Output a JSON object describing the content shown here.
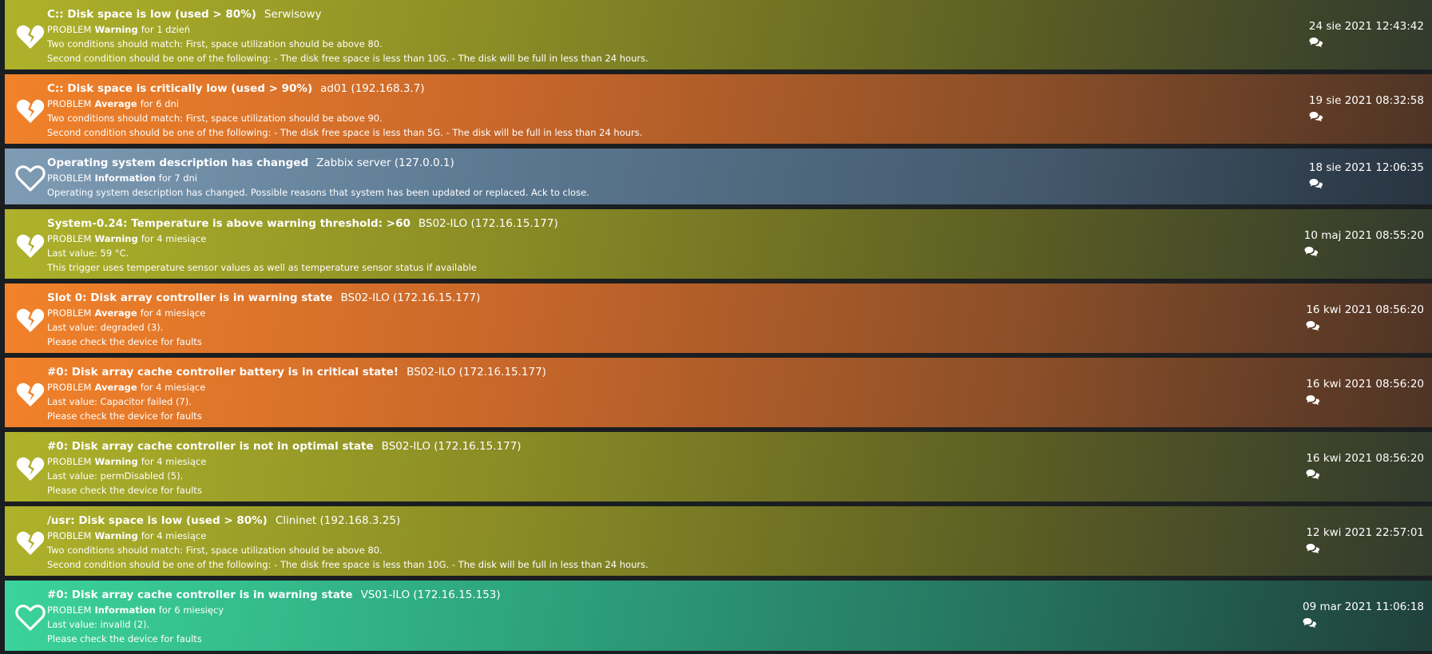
{
  "colors": {
    "warning": "#aeb22a",
    "average": "#f2822a",
    "information": "#7f9cb5",
    "information_green": "#3bd39c",
    "background": "#1b1e20"
  },
  "icons": {
    "broken": "broken-heart-icon",
    "whole": "heart-icon",
    "comment": "comment-icon"
  },
  "problems": [
    {
      "trigger": "C:: Disk space is low (used > 80%)",
      "host": "Serwisowy",
      "status": "PROBLEM",
      "severity": "Warning",
      "duration": "for 1 dzień",
      "desc": [
        "Two conditions should match: First, space utilization should be above 80.",
        "Second condition should be one of the following: - The disk free space is less than 10G. - The disk will be full in less than 24 hours."
      ],
      "time": "24 sie 2021 12:43:42"
    },
    {
      "trigger": "C:: Disk space is critically low (used > 90%)",
      "host": "ad01 (192.168.3.7)",
      "status": "PROBLEM",
      "severity": "Average",
      "duration": "for 6 dni",
      "desc": [
        "Two conditions should match: First, space utilization should be above 90.",
        "Second condition should be one of the following: - The disk free space is less than 5G. - The disk will be full in less than 24 hours."
      ],
      "time": "19 sie 2021 08:32:58"
    },
    {
      "trigger": "Operating system description has changed",
      "host": "Zabbix server (127.0.0.1)",
      "status": "PROBLEM",
      "severity": "Information",
      "duration": "for 7 dni",
      "desc": [
        "Operating system description has changed. Possible reasons that system has been updated or replaced. Ack to close."
      ],
      "time": "18 sie 2021 12:06:35"
    },
    {
      "trigger": "System-0.24: Temperature is above warning threshold: >60",
      "host": "BS02-ILO (172.16.15.177)",
      "status": "PROBLEM",
      "severity": "Warning",
      "duration": "for 4 miesiące",
      "desc": [
        "Last value: 59 °C.",
        "This trigger uses temperature sensor values as well as temperature sensor status if available"
      ],
      "time": "10 maj 2021 08:55:20"
    },
    {
      "trigger": "Slot 0: Disk array controller is in warning state",
      "host": "BS02-ILO (172.16.15.177)",
      "status": "PROBLEM",
      "severity": "Average",
      "duration": "for 4 miesiące",
      "desc": [
        "Last value: degraded (3).",
        "Please check the device for faults"
      ],
      "time": "16 kwi 2021 08:56:20"
    },
    {
      "trigger": "#0: Disk array cache controller battery is in critical state!",
      "host": "BS02-ILO (172.16.15.177)",
      "status": "PROBLEM",
      "severity": "Average",
      "duration": "for 4 miesiące",
      "desc": [
        "Last value: Capacitor failed (7).",
        "Please check the device for faults"
      ],
      "time": "16 kwi 2021 08:56:20"
    },
    {
      "trigger": "#0: Disk array cache controller is not in optimal state",
      "host": "BS02-ILO (172.16.15.177)",
      "status": "PROBLEM",
      "severity": "Warning",
      "duration": "for 4 miesiące",
      "desc": [
        "Last value: permDisabled (5).",
        "Please check the device for faults"
      ],
      "time": "16 kwi 2021 08:56:20"
    },
    {
      "trigger": "/usr: Disk space is low (used > 80%)",
      "host": "Clininet (192.168.3.25)",
      "status": "PROBLEM",
      "severity": "Warning",
      "duration": "for 4 miesiące",
      "desc": [
        "Two conditions should match: First, space utilization should be above 80.",
        "Second condition should be one of the following: - The disk free space is less than 10G. - The disk will be full in less than 24 hours."
      ],
      "time": "12 kwi 2021 22:57:01"
    },
    {
      "trigger": "#0: Disk array cache controller is in warning state",
      "host": "VS01-ILO (172.16.15.153)",
      "status": "PROBLEM",
      "severity": "Information",
      "duration": "for 6 miesięcy",
      "desc": [
        "Last value: invalid (2).",
        "Please check the device for faults"
      ],
      "time": "09 mar 2021 11:06:18"
    }
  ]
}
